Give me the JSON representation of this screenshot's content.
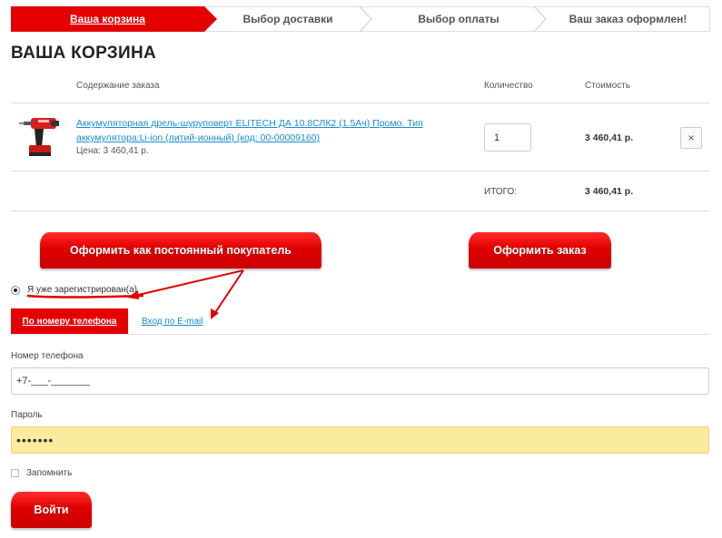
{
  "steps": [
    {
      "label": "Ваша корзина"
    },
    {
      "label": "Выбор доставки"
    },
    {
      "label": "Выбор оплаты"
    },
    {
      "label": "Ваш заказ оформлен!"
    }
  ],
  "page_title": "ВАША КОРЗИНА",
  "table": {
    "headers": {
      "content": "Содержание заказа",
      "quantity": "Количество",
      "cost": "Стоимость"
    },
    "items": [
      {
        "name": "Аккумуляторная дрель-шуруповерт ELITECH ДА 10.8СЛК2 (1.5Ач) Промо. Тип аккумулятора:Li-ion (литий-ионный) (код: 00-00009160)",
        "price_line": "Цена: 3 460,41 р.",
        "quantity": "1",
        "cost": "3 460,41 р.",
        "remove_symbol": "×"
      }
    ],
    "total_label": "ИТОГО:",
    "total_value": "3 460,41 р."
  },
  "buttons": {
    "regular_customer": "Оформить как постоянный покупатель",
    "place_order": "Оформить заказ",
    "login": "Войти"
  },
  "auth": {
    "registered_label": "Я уже зарегистрирован(а)",
    "tab_phone": "По номеру телефона",
    "tab_email": "Вход по E-mail",
    "phone_label": "Номер телефона",
    "phone_value": "+7-___-_______",
    "password_label": "Пароль",
    "password_value": "•••••••",
    "remember_label": "Запомнить"
  },
  "colors": {
    "accent_red": "#e50000",
    "link_blue": "#1a8bd1",
    "autofill_yellow": "#faeb9e"
  },
  "icons": {
    "product": "drill-image",
    "remove": "close-icon"
  }
}
